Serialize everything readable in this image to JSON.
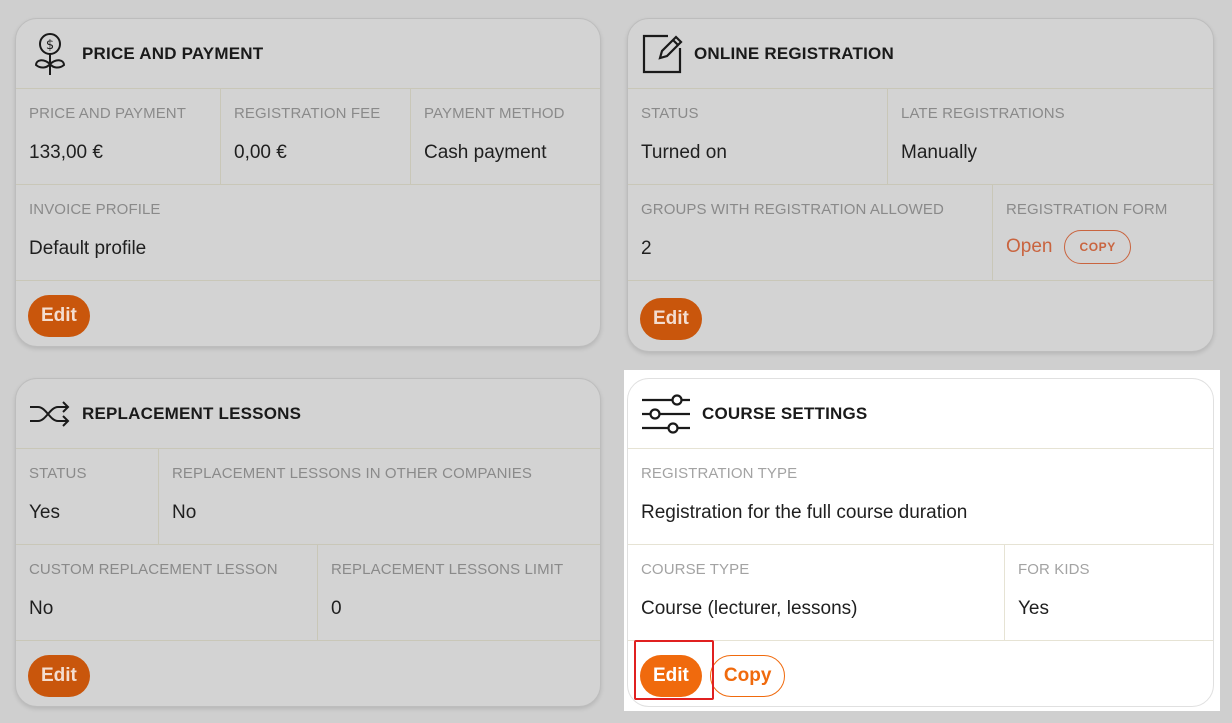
{
  "price_payment": {
    "title": "PRICE AND PAYMENT",
    "icon": "money-plant-icon",
    "fields": [
      {
        "label": "PRICE AND PAYMENT",
        "value": "133,00 €"
      },
      {
        "label": "REGISTRATION FEE",
        "value": "0,00 €"
      },
      {
        "label": "PAYMENT METHOD",
        "value": "Cash payment"
      }
    ],
    "invoice": {
      "label": "INVOICE PROFILE",
      "value": "Default profile"
    },
    "edit_label": "Edit"
  },
  "online_registration": {
    "title": "ONLINE REGISTRATION",
    "icon": "edit-note-icon",
    "status": {
      "label": "STATUS",
      "value": "Turned on"
    },
    "late": {
      "label": "LATE REGISTRATIONS",
      "value": "Manually"
    },
    "groups": {
      "label": "GROUPS WITH REGISTRATION ALLOWED",
      "value": "2"
    },
    "form": {
      "label": "REGISTRATION FORM",
      "open_label": "Open",
      "copy_label": "COPY"
    },
    "edit_label": "Edit"
  },
  "replacement_lessons": {
    "title": "REPLACEMENT LESSONS",
    "icon": "shuffle-icon",
    "status": {
      "label": "STATUS",
      "value": "Yes"
    },
    "other_companies": {
      "label": "REPLACEMENT LESSONS IN OTHER COMPANIES",
      "value": "No"
    },
    "custom": {
      "label": "CUSTOM REPLACEMENT LESSON",
      "value": "No"
    },
    "limit": {
      "label": "REPLACEMENT LESSONS LIMIT",
      "value": "0"
    },
    "edit_label": "Edit"
  },
  "course_settings": {
    "title": "COURSE SETTINGS",
    "icon": "sliders-icon",
    "registration_type": {
      "label": "REGISTRATION TYPE",
      "value": "Registration for the full course duration"
    },
    "course_type": {
      "label": "COURSE TYPE",
      "value": "Course (lecturer, lessons)"
    },
    "for_kids": {
      "label": "FOR KIDS",
      "value": "Yes"
    },
    "edit_label": "Edit",
    "copy_label": "Copy"
  },
  "colors": {
    "accent": "#f06a0d",
    "accent_dim": "#c9560c",
    "highlight": "#e02020"
  }
}
